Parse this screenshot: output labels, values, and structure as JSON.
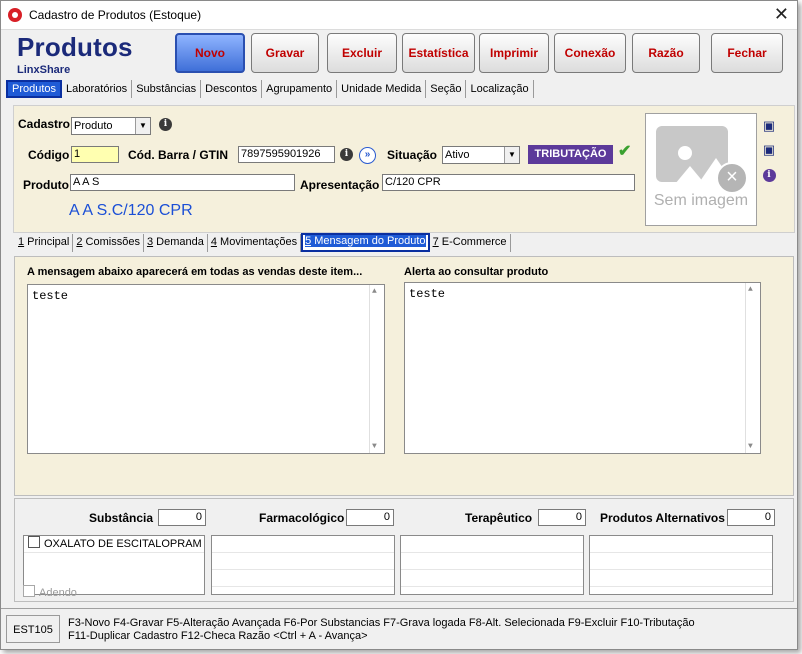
{
  "window": {
    "title": "Cadastro de Produtos (Estoque)",
    "close_glyph": "✕"
  },
  "header": {
    "title": "Produtos",
    "subtitle": "LinxShare"
  },
  "toolbar": [
    {
      "label": "Novo",
      "active": true
    },
    {
      "label": "Gravar",
      "active": false
    },
    {
      "label": "Excluir",
      "active": false
    },
    {
      "label": "Estatística",
      "active": false
    },
    {
      "label": "Imprimir",
      "active": false
    },
    {
      "label": "Conexão",
      "active": false
    },
    {
      "label": "Razão",
      "active": false
    },
    {
      "label": "Fechar",
      "active": false
    }
  ],
  "top_tabs": [
    {
      "label": "Produtos",
      "selected": true
    },
    {
      "label": "Laboratórios"
    },
    {
      "label": "Substâncias"
    },
    {
      "label": "Descontos"
    },
    {
      "label": "Agrupamento"
    },
    {
      "label": "Unidade Medida"
    },
    {
      "label": "Seção"
    },
    {
      "label": "Localização"
    }
  ],
  "form": {
    "cadastro_label": "Cadastro",
    "cadastro_value": "Produto",
    "codigo_label": "Código",
    "codigo_value": "1",
    "barcode_label": "Cód. Barra / GTIN",
    "barcode_value": "7897595901926",
    "situacao_label": "Situação",
    "situacao_value": "Ativo",
    "tributacao_label": "TRIBUTAÇÃO",
    "produto_label": "Produto",
    "produto_value": "A A S",
    "apresentacao_label": "Apresentação",
    "apresentacao_value": "C/120 CPR",
    "display_name": "A A S.C/120 CPR",
    "image_placeholder": "Sem imagem"
  },
  "sub_tabs": [
    {
      "key": "1",
      "label": " Principal"
    },
    {
      "key": "2",
      "label": " Comissões"
    },
    {
      "key": "3",
      "label": " Demanda"
    },
    {
      "key": "4",
      "label": " Movimentações"
    },
    {
      "key": "5",
      "label": " Mensagem do Produto",
      "selected": true
    },
    {
      "key": "7",
      "label": " E-Commerce"
    }
  ],
  "messages": {
    "left_label": "A mensagem abaixo aparecerá em todas as vendas deste item...",
    "left_text": "teste",
    "right_label": "Alerta ao consultar produto",
    "right_text": "teste"
  },
  "bottom": {
    "substancia_label": "Substância",
    "substancia_count": "0",
    "farmaco_label": "Farmacológico",
    "farmaco_count": "0",
    "terapeutico_label": "Terapêutico",
    "terapeutico_count": "0",
    "alternativos_label": "Produtos Alternativos",
    "alternativos_count": "0",
    "substancia_item": "OXALATO DE ESCITALOPRAM",
    "adendo_label": "Adendo"
  },
  "status": {
    "code": "EST105",
    "line1": "F3-Novo  F4-Gravar  F5-Alteração Avançada  F6-Por Substancias  F7-Grava logada  F8-Alt. Selecionada  F9-Excluir  F10-Tributação",
    "line2": "F11-Duplicar Cadastro  F12-Checa Razão  <Ctrl + A - Avança>"
  },
  "colors": {
    "brand": "#1b2a7a",
    "accent": "#1f5bd6",
    "tributacao": "#5c3a9a",
    "button_text": "#c00000",
    "panel": "#f5f0dc"
  }
}
